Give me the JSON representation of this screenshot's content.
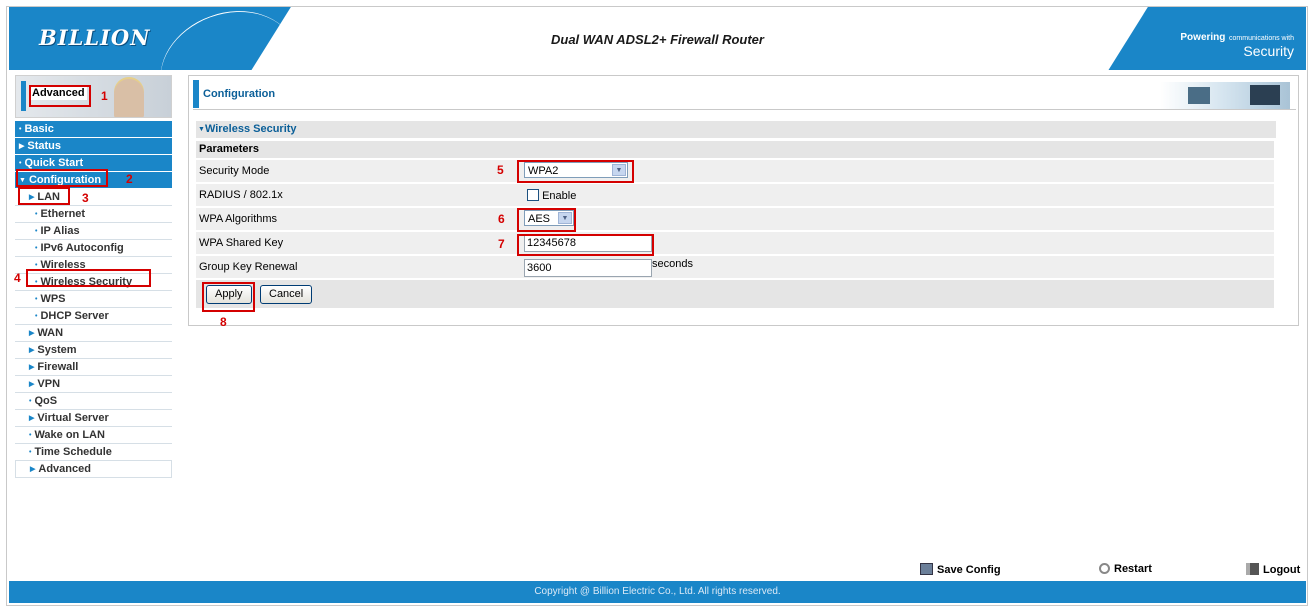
{
  "header": {
    "logo": "BILLION",
    "title": "Dual WAN ADSL2+ Firewall Router",
    "slogan_powering": "Powering",
    "slogan_small": "communications with",
    "slogan_security": "Security"
  },
  "sidebar": {
    "banner_label": "Advanced",
    "items": [
      {
        "label": "Basic"
      },
      {
        "label": "Status"
      },
      {
        "label": "Quick Start"
      },
      {
        "label": "Configuration"
      },
      {
        "label": "LAN"
      },
      {
        "label": "Ethernet"
      },
      {
        "label": "IP Alias"
      },
      {
        "label": "IPv6 Autoconfig"
      },
      {
        "label": "Wireless"
      },
      {
        "label": "Wireless Security"
      },
      {
        "label": "WPS"
      },
      {
        "label": "DHCP Server"
      },
      {
        "label": "WAN"
      },
      {
        "label": "System"
      },
      {
        "label": "Firewall"
      },
      {
        "label": "VPN"
      },
      {
        "label": "QoS"
      },
      {
        "label": "Virtual Server"
      },
      {
        "label": "Wake on LAN"
      },
      {
        "label": "Time Schedule"
      },
      {
        "label": "Advanced"
      }
    ]
  },
  "main": {
    "title": "Configuration",
    "section": "Wireless Security",
    "params_header": "Parameters",
    "security_mode": {
      "label": "Security Mode",
      "value": "WPA2"
    },
    "radius": {
      "label": "RADIUS / 802.1x",
      "checkbox_label": "Enable",
      "checked": false
    },
    "wpa_algorithms": {
      "label": "WPA Algorithms",
      "value": "AES"
    },
    "wpa_shared_key": {
      "label": "WPA Shared Key",
      "value": "12345678"
    },
    "group_key_renewal": {
      "label": "Group Key Renewal",
      "value": "3600",
      "unit": "seconds"
    },
    "apply_label": "Apply",
    "cancel_label": "Cancel"
  },
  "annotations": [
    "1",
    "2",
    "3",
    "4",
    "5",
    "6",
    "7",
    "8"
  ],
  "footer_links": {
    "save": "Save Config",
    "restart": "Restart",
    "logout": "Logout"
  },
  "copyright": "Copyright @ Billion Electric Co., Ltd. All rights reserved.",
  "colors": {
    "brand_blue": "#1a86c8",
    "annotation_red": "#d40000",
    "title_blue": "#0b5f98"
  }
}
